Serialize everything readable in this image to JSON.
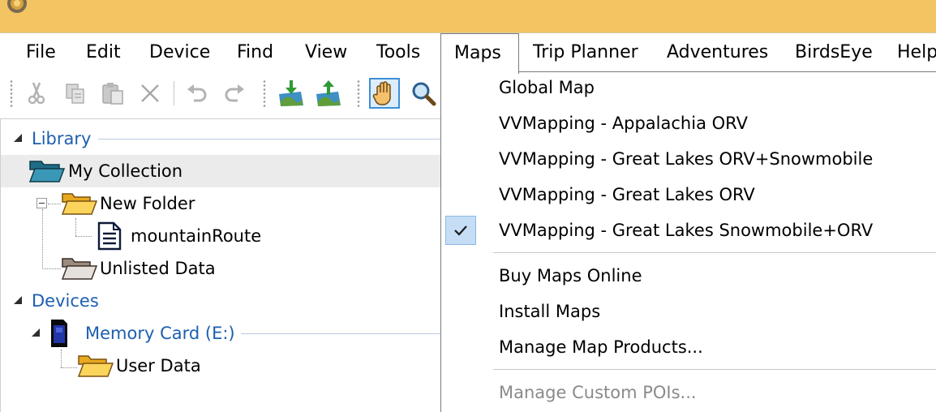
{
  "colors": {
    "titlebar": "#f2c462",
    "link_blue": "#1c5fb0",
    "check_bg": "#c5def5",
    "disabled_text": "#8a8a8a"
  },
  "menubar": {
    "items": [
      {
        "label": "File"
      },
      {
        "label": "Edit"
      },
      {
        "label": "Device"
      },
      {
        "label": "Find"
      },
      {
        "label": "View"
      },
      {
        "label": "Tools"
      },
      {
        "label": "Maps",
        "state": "open"
      },
      {
        "label": "Trip Planner"
      },
      {
        "label": "Adventures"
      },
      {
        "label": "BirdsEye"
      },
      {
        "label": "Help"
      }
    ]
  },
  "toolbar": {
    "buttons": [
      {
        "icon": "cut-icon",
        "enabled": false
      },
      {
        "icon": "copy-icon",
        "enabled": false
      },
      {
        "icon": "paste-icon",
        "enabled": false
      },
      {
        "icon": "delete-icon",
        "enabled": false
      },
      {
        "icon": "undo-icon",
        "enabled": false
      },
      {
        "icon": "redo-icon",
        "enabled": false
      },
      {
        "icon": "receive-from-device-icon",
        "enabled": true
      },
      {
        "icon": "send-to-device-icon",
        "enabled": true
      },
      {
        "icon": "hand-pan-icon",
        "enabled": true,
        "pressed": true
      },
      {
        "icon": "zoom-icon",
        "enabled": true
      }
    ]
  },
  "tree": {
    "library": {
      "label": "Library",
      "collection": "My Collection",
      "new_folder": "New Folder",
      "route": "mountainRoute",
      "unlisted": "Unlisted Data"
    },
    "devices": {
      "label": "Devices",
      "memory_card": "Memory Card (E:)",
      "user_data": "User Data"
    }
  },
  "maps_menu": {
    "items": [
      {
        "label": "Global Map",
        "checked": false
      },
      {
        "label": "VVMapping - Appalachia ORV",
        "checked": false
      },
      {
        "label": "VVMapping - Great Lakes ORV+Snowmobile",
        "checked": false
      },
      {
        "label": "VVMapping - Great Lakes ORV",
        "checked": false
      },
      {
        "label": "VVMapping - Great Lakes Snowmobile+ORV",
        "checked": true
      },
      {
        "label": "Buy Maps Online"
      },
      {
        "label": "Install Maps"
      },
      {
        "label": "Manage Map Products..."
      },
      {
        "label": "Manage Custom POIs...",
        "disabled": true
      }
    ]
  }
}
